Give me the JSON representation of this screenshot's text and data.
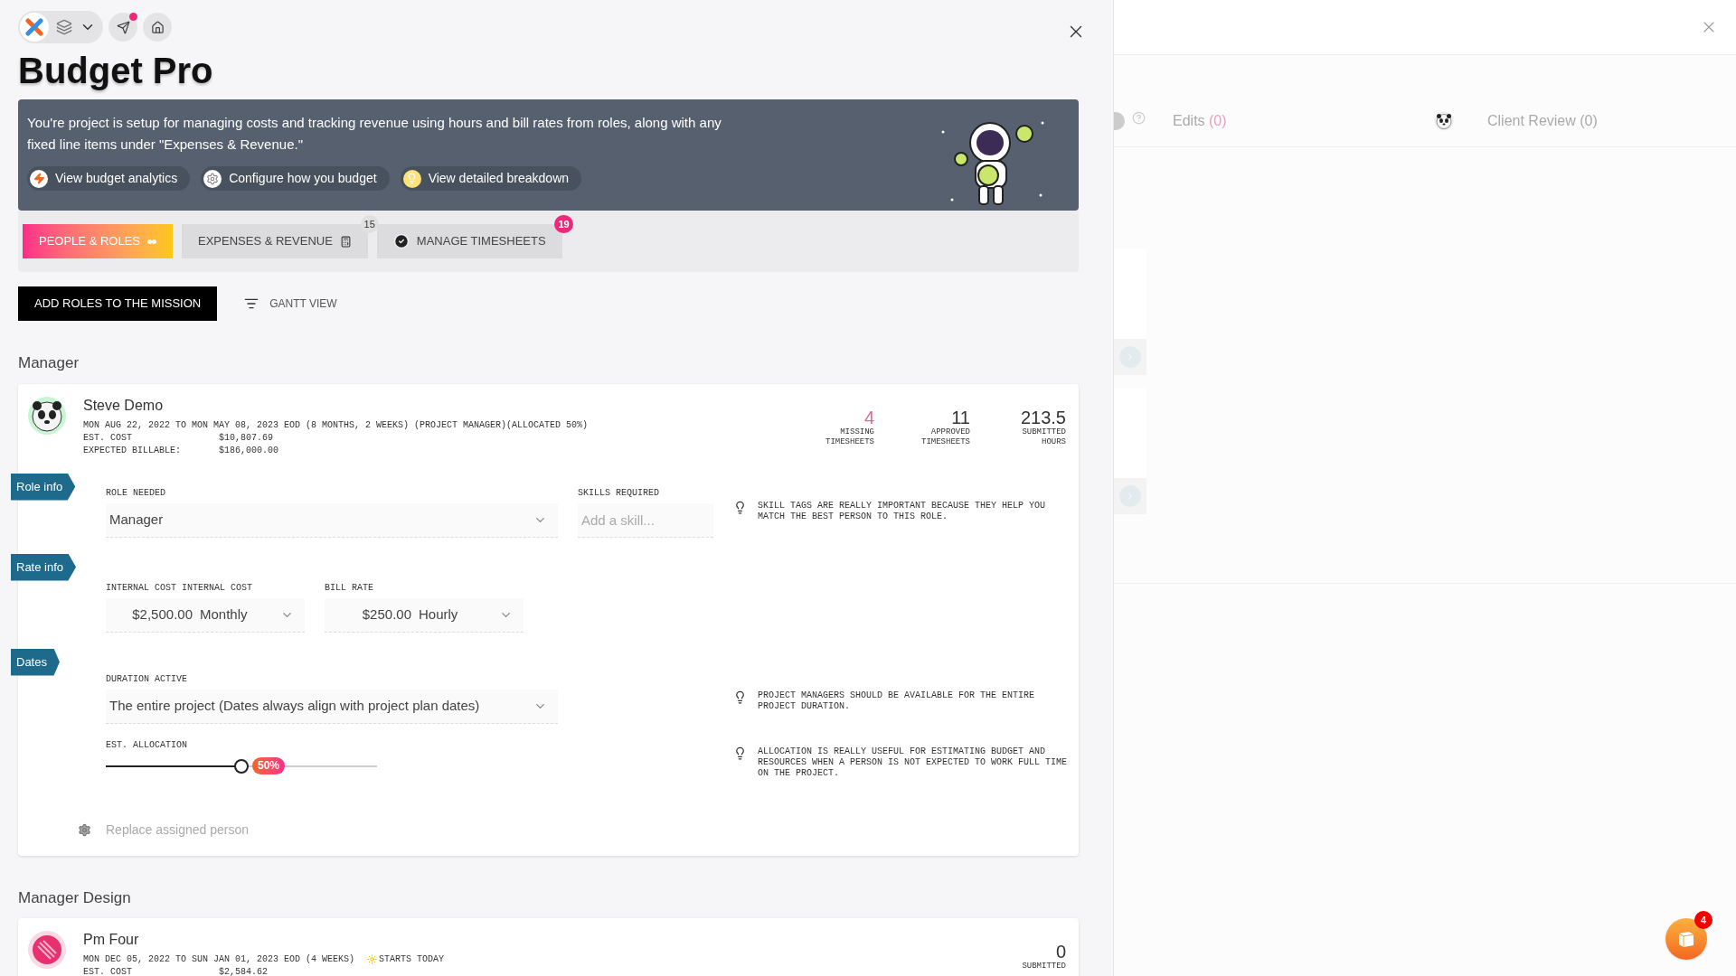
{
  "title": "Budget Pro",
  "banner": {
    "text": "You're project is setup for managing costs and tracking revenue using hours and bill rates from roles, along with any fixed line items under \"Expenses & Revenue.\"",
    "links": [
      {
        "label": "View budget analytics",
        "kind": "analytics"
      },
      {
        "label": "Configure how you budget",
        "kind": "configure"
      },
      {
        "label": "View detailed breakdown",
        "kind": "breakdown"
      }
    ]
  },
  "tabs": [
    {
      "label": "PEOPLE & ROLES",
      "selected": true,
      "kind": "people"
    },
    {
      "label": "EXPENSES & REVENUE",
      "selected": false,
      "kind": "expenses",
      "badge": {
        "text": "15",
        "color": "#e0e0e0"
      }
    },
    {
      "label": "MANAGE TIMESHEETS",
      "selected": false,
      "kind": "timesheets",
      "badge": {
        "text": "19",
        "color": "#f0287a"
      }
    }
  ],
  "actions": {
    "primary": "ADD ROLES TO THE MISSION",
    "secondary": "GANTT VIEW"
  },
  "sections": [
    {
      "heading": "Manager",
      "person": {
        "name": "Steve Demo",
        "kind": "panda",
        "date_range": "MON AUG 22, 2022 TO MON MAY 08, 2023 EOD",
        "meta": [
          {
            "kind": "text",
            "text": "(8 MONTHS, 2 WEEKS)"
          },
          {
            "kind": "text",
            "text": "(PROJECT MANAGER)(ALLOCATED 50%)"
          }
        ],
        "costs": [
          {
            "label": "EST. COST",
            "value": "$10,807.69"
          },
          {
            "label": "EXPECTED BILLABLE:",
            "value": "$186,000.00"
          }
        ]
      },
      "stats": [
        {
          "value": "4",
          "label": "MISSING TIMESHEETS",
          "color": "#e0679a"
        },
        {
          "value": "11",
          "label": "APPROVED TIMESHEETS",
          "color": "#333333"
        },
        {
          "value": "213.5",
          "label": "SUBMITTED HOURS",
          "color": "#333333"
        }
      ],
      "form": {
        "role_tag": "Role info",
        "role_needed": {
          "label": "ROLE NEEDED",
          "value": "Manager"
        },
        "skills": {
          "label": "SKILLS REQUIRED",
          "placeholder": "Add a skill..."
        },
        "skills_tip": "SKILL TAGS ARE REALLY IMPORTANT BECAUSE THEY HELP YOU MATCH THE BEST PERSON TO THIS ROLE.",
        "rate_tag": "Rate info",
        "internal_cost": {
          "label": "INTERNAL COST INTERNAL COST",
          "amount": "$2,500.00",
          "unit": "Monthly"
        },
        "bill_rate": {
          "label": "BILL RATE",
          "amount": "$250.00",
          "unit": "Hourly"
        },
        "dates_tag": "Dates",
        "duration": {
          "label": "DURATION ACTIVE",
          "value": "The entire project (Dates always align with project plan dates)"
        },
        "duration_tip": "PROJECT MANAGERS SHOULD BE AVAILABLE FOR THE ENTIRE PROJECT DURATION.",
        "allocation": {
          "label": "EST. ALLOCATION",
          "level": 0.5,
          "reading": "50%"
        },
        "allocation_tip": "ALLOCATION IS REALLY USEFUL FOR ESTIMATING BUDGET AND RESOURCES WHEN A PERSON IS NOT EXPECTED TO WORK FULL TIME ON THE PROJECT.",
        "replace_link": "Replace assigned person"
      }
    },
    {
      "heading": "Manager Design",
      "person": {
        "name": "Pm Four",
        "kind": "zebra",
        "date_range": "MON DEC 05, 2022 TO SUN JAN 01, 2023 EOD",
        "meta": [
          {
            "kind": "text",
            "text": "(4 WEEKS)"
          },
          {
            "kind": "starts",
            "text": "STARTS TODAY"
          }
        ],
        "costs": [
          {
            "label": "EST. COST",
            "value": "$2,584.62"
          }
        ]
      },
      "stats": [
        {
          "value": "0",
          "label": "SUBMITTED",
          "color": "#333333"
        }
      ]
    }
  ],
  "right_panel": {
    "columns": [
      {
        "label": "Edits",
        "count": "(0)",
        "highlight": true
      },
      {
        "label": "Client Review",
        "count": "(0)",
        "highlight": false
      }
    ]
  },
  "help_fab": {
    "badge": "4"
  }
}
